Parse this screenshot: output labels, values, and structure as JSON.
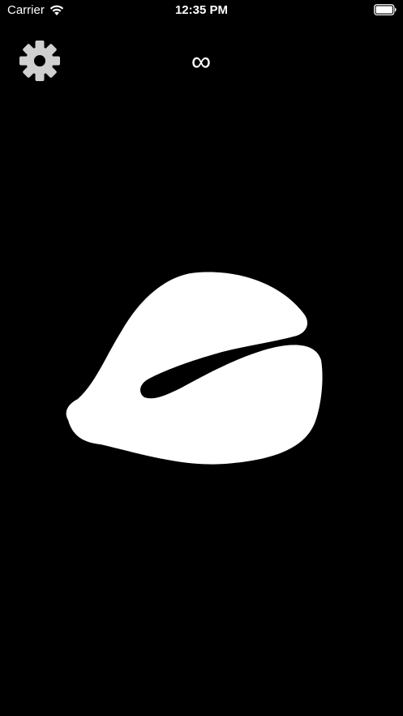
{
  "status_bar": {
    "carrier": "Carrier",
    "time": "12:35 PM",
    "wifi_icon": "wifi-icon",
    "battery_icon": "battery-icon"
  },
  "toolbar": {
    "settings_icon": "gear-icon",
    "counter": "∞"
  },
  "canvas": {
    "shape": "white-blob-shape",
    "background": "#000000",
    "shape_color": "#ffffff"
  }
}
